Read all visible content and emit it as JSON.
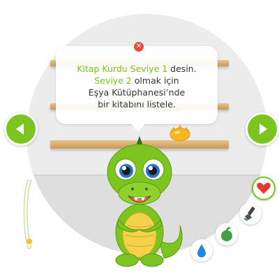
{
  "bubble": {
    "line1_highlight": "Kitap Kurdu Seviye 1",
    "line1_rest": " desin.",
    "line2_highlight": "Seviye 2",
    "line2_rest": " olmak için",
    "line3": "Eşya Kütüphanesi’nde",
    "line4": "bir kitabını listele."
  },
  "controls": {
    "close_icon": "close-icon",
    "prev_icon": "chevron-left-icon",
    "next_icon": "chevron-right-icon"
  },
  "actions": [
    {
      "name": "heart-button",
      "icon": "heart-icon",
      "color": "#e53935",
      "active": true
    },
    {
      "name": "clean-button",
      "icon": "brush-icon",
      "color": "#555555",
      "active": false
    },
    {
      "name": "feed-button",
      "icon": "apple-icon",
      "color": "#43a047",
      "active": false
    },
    {
      "name": "water-button",
      "icon": "water-drop-icon",
      "color": "#1e88e5",
      "active": false
    }
  ],
  "colors": {
    "accent": "#7cc420",
    "highlight_text": "#7cc120"
  }
}
